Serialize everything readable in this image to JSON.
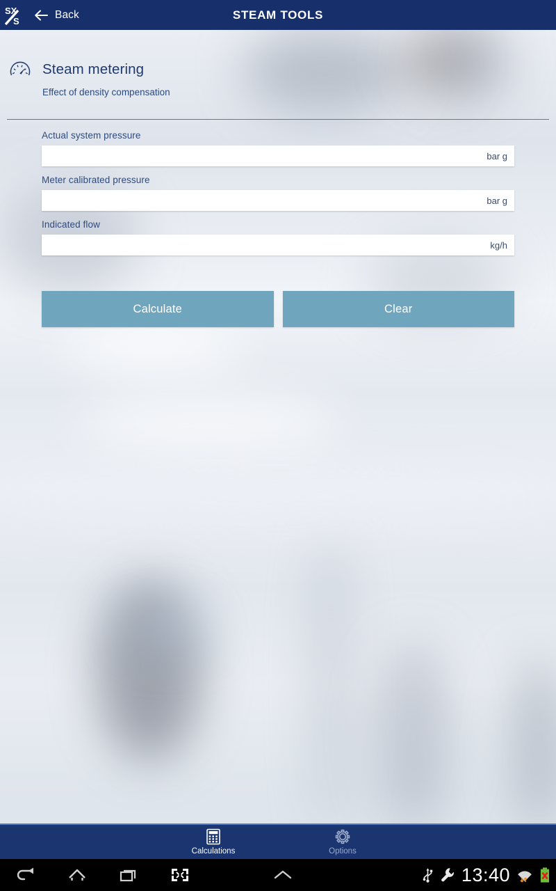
{
  "appbar": {
    "logo_icon": "spirax-sarco-logo",
    "back_icon": "arrow-left-icon",
    "back_label": "Back",
    "title": "STEAM TOOLS",
    "background_color": "#17306b"
  },
  "heading": {
    "icon": "gauge-icon",
    "title": "Steam metering",
    "subtitle": "Effect of density compensation",
    "title_color": "#1e3a6e"
  },
  "form": {
    "fields": [
      {
        "label": "Actual system pressure",
        "value": "",
        "placeholder": "",
        "unit": "bar g"
      },
      {
        "label": "Meter calibrated pressure",
        "value": "",
        "placeholder": "",
        "unit": "bar g"
      },
      {
        "label": "Indicated flow",
        "value": "",
        "placeholder": "",
        "unit": "kg/h"
      }
    ]
  },
  "buttons": {
    "calculate_label": "Calculate",
    "clear_label": "Clear",
    "color": "#6fa6bd"
  },
  "tabbar": {
    "background_color": "#1a3570",
    "tabs": [
      {
        "label": "Calculations",
        "icon": "calculator-icon",
        "active": true
      },
      {
        "label": "Options",
        "icon": "gear-icon",
        "active": false
      }
    ]
  },
  "systembar": {
    "nav_icons": [
      "back-icon",
      "home-icon",
      "recents-icon",
      "screenshot-icon",
      "chevron-up-icon"
    ],
    "status_icons": [
      "usb-icon",
      "wrench-icon"
    ],
    "clock": "13:40",
    "right_icons": [
      "wifi-icon",
      "battery-error-icon"
    ]
  }
}
